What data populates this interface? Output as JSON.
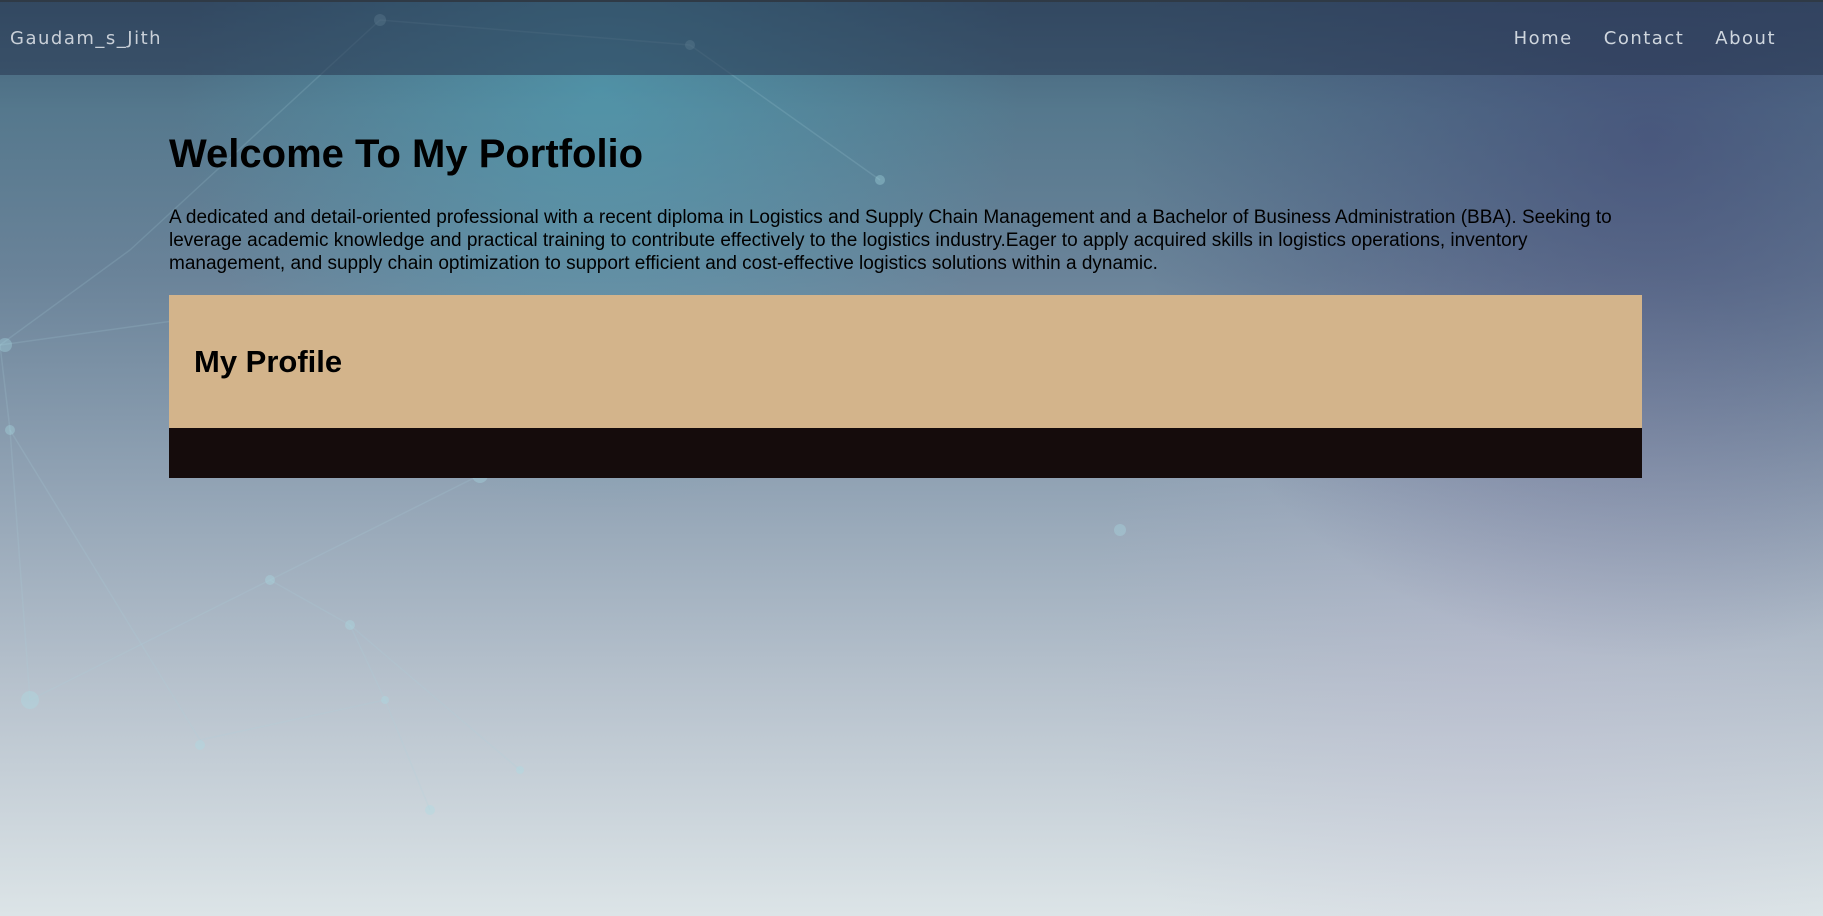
{
  "navbar": {
    "brand": "Gaudam_s_Jith",
    "links": [
      {
        "label": "Home"
      },
      {
        "label": "Contact"
      },
      {
        "label": "About"
      }
    ]
  },
  "main": {
    "title": "Welcome To My Portfolio",
    "intro": "A dedicated and detail-oriented professional with a recent diploma in Logistics and Supply Chain Management and a Bachelor of Business Administration (BBA). Seeking to leverage academic knowledge and practical training to contribute effectively to the logistics industry.Eager to apply acquired skills in logistics operations, inventory management, and supply chain optimization to support efficient and cost-effective logistics solutions within a dynamic.",
    "profile_section": {
      "title": "My Profile"
    }
  },
  "colors": {
    "profile_card": "#d3b48b",
    "profile_footer": "#150c0c",
    "nav_text": "#cfd6de"
  }
}
